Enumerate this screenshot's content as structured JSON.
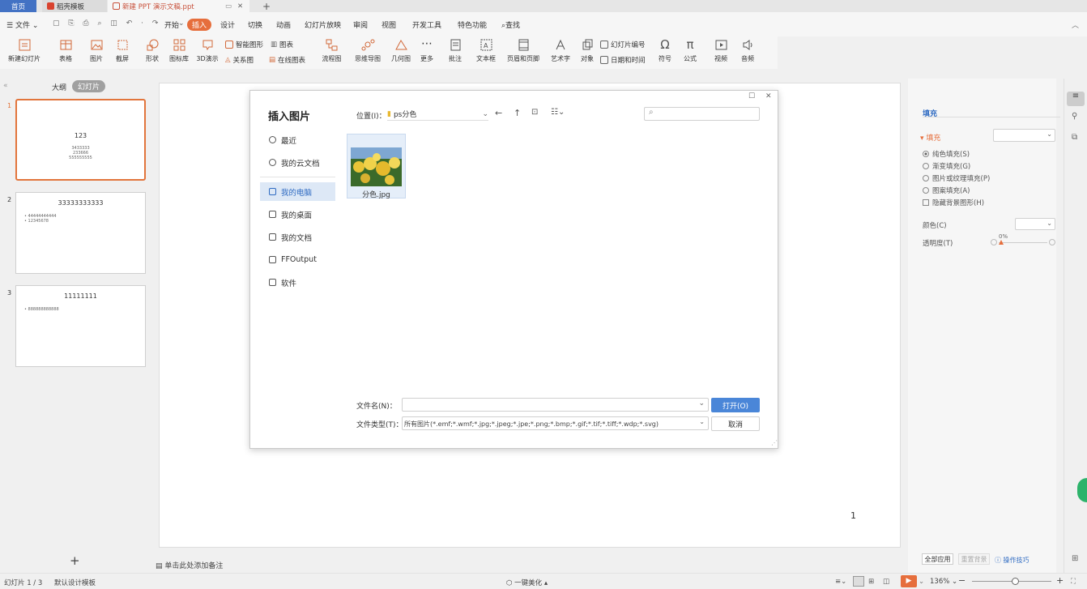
{
  "tabs": {
    "home": "首页",
    "template": "稻壳模板",
    "doc": "新建 PPT 演示文稿.ppt",
    "add": "+"
  },
  "menu": {
    "file": "文件",
    "items": [
      "开始",
      "插入",
      "设计",
      "切换",
      "动画",
      "幻灯片放映",
      "审阅",
      "视图",
      "开发工具",
      "特色功能"
    ],
    "search": "查找"
  },
  "ribbon": {
    "new_slide": "新建幻灯片",
    "table": "表格",
    "picture": "图片",
    "screenshot": "截屏",
    "shape": "形状",
    "icon_lib": "图标库",
    "3d": "3D演示",
    "smart_shape": "智能图形",
    "chart": "图表",
    "relation": "关系图",
    "online_chart": "在线图表",
    "flowchart": "流程图",
    "mindmap": "思维导图",
    "geometry": "几何图",
    "more": "更多",
    "comment": "批注",
    "textbox": "文本框",
    "header_footer": "页眉和页脚",
    "wordart": "艺术字",
    "object": "对象",
    "slide_number": "幻灯片编号",
    "datetime": "日期和时间",
    "symbol": "符号",
    "formula": "公式",
    "video": "视频",
    "audio": "音频"
  },
  "leftpane": {
    "outline": "大纲",
    "slides": "幻灯片",
    "thumbs": [
      {
        "num": "1",
        "title": "123",
        "lines": [
          "3433333",
          "233666",
          "555555555"
        ]
      },
      {
        "num": "2",
        "title": "33333333333",
        "lines": [
          "• 44444444444",
          "• 12345678"
        ]
      },
      {
        "num": "3",
        "title": "11111111",
        "lines": [
          "• 888888888888"
        ]
      }
    ],
    "add": "+"
  },
  "slide": {
    "page_number": "1",
    "notes": "单击此处添加备注"
  },
  "dialog": {
    "title": "插入图片",
    "location_label": "位置(I)：",
    "location_value": "ps分色",
    "nav": [
      "最近",
      "我的云文档",
      "我的电脑",
      "我的桌面",
      "我的文档",
      "FFOutput",
      "软件"
    ],
    "file_name": "分色.jpg",
    "filename_label": "文件名(N)：",
    "filename_value": "",
    "filetype_label": "文件类型(T)：",
    "filetype_value": "所有图片(*.emf;*.wmf;*.jpg;*.jpeg;*.jpe;*.png;*.bmp;*.gif;*.tif;*.tiff;*.wdp;*.svg)",
    "open": "打开(O)",
    "cancel": "取消"
  },
  "rightpane": {
    "header": "填充",
    "section": "填充",
    "options": [
      "纯色填充(S)",
      "渐变填充(G)",
      "图片或纹理填充(P)",
      "图案填充(A)"
    ],
    "hide_bg": "隐藏背景图形(H)",
    "color_label": "颜色(C)",
    "transparency_label": "透明度(T)",
    "transparency_value": "0%",
    "apply_all": "全部应用",
    "reset_bg": "重置背景",
    "tips": "操作技巧"
  },
  "status": {
    "slide_count": "幻灯片 1 / 3",
    "template": "默认设计模板",
    "beautify": "一键美化",
    "zoom": "136%"
  },
  "colors": {
    "accent": "#e66e3c",
    "blue": "#2f6bc2",
    "open_btn": "#4a86d8"
  }
}
